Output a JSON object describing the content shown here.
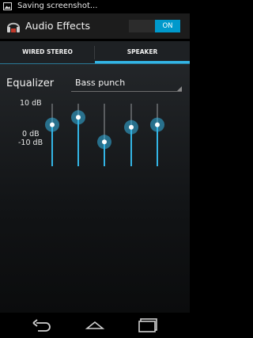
{
  "status_bar": {
    "text": "Saving screenshot..."
  },
  "action_bar": {
    "title": "Audio Effects",
    "toggle_label": "ON"
  },
  "tabs": [
    {
      "label": "WIRED STEREO",
      "selected": false
    },
    {
      "label": "SPEAKER",
      "selected": true
    }
  ],
  "equalizer": {
    "label": "Equalizer",
    "preset": "Bass punch",
    "db_labels": {
      "top": "10 dB",
      "mid": "0 dB",
      "bottom": "-10 dB"
    },
    "band_levels_db": [
      4,
      7,
      -3,
      3,
      4
    ]
  },
  "colors": {
    "accent": "#33b5e5",
    "toggle_on": "#0099cc"
  },
  "nav": {
    "back_icon": "back-icon",
    "home_icon": "home-icon",
    "recents_icon": "recents-icon"
  }
}
